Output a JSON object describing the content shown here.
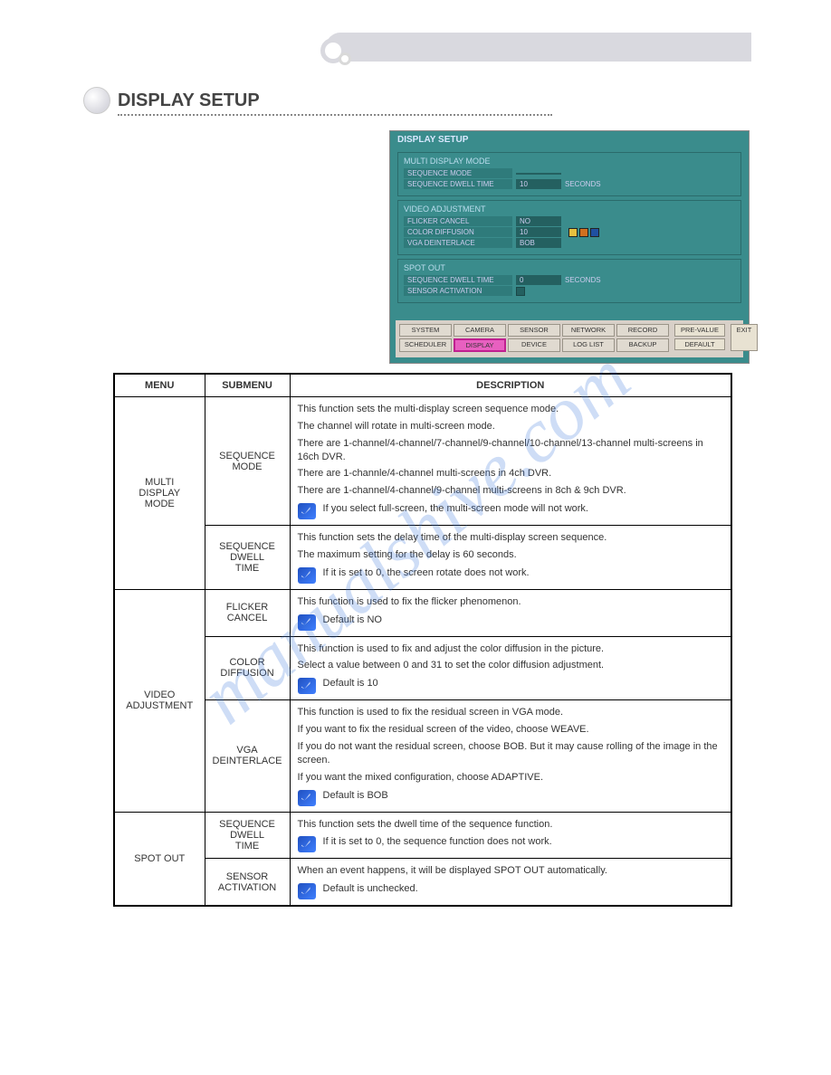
{
  "section_title": "DISPLAY SETUP",
  "watermark": "manualshive.com",
  "screenshot": {
    "title": "DISPLAY SETUP",
    "groups": [
      {
        "title": "MULTI DISPLAY MODE",
        "rows": [
          {
            "label": "SEQUENCE MODE",
            "value": ""
          },
          {
            "label": "SEQUENCE DWELL TIME",
            "value": "10",
            "unit": "SECONDS"
          }
        ]
      },
      {
        "title": "VIDEO ADJUSTMENT",
        "rows": [
          {
            "label": "FLICKER CANCEL",
            "value": "NO"
          },
          {
            "label": "COLOR DIFFUSION",
            "value": "10",
            "swatches": true
          },
          {
            "label": "VGA DEINTERLACE",
            "value": "BOB"
          }
        ]
      },
      {
        "title": "SPOT OUT",
        "rows": [
          {
            "label": "SEQUENCE DWELL TIME",
            "value": "0",
            "unit": "SECONDS"
          },
          {
            "label": "SENSOR ACTIVATION",
            "checkbox": true
          }
        ]
      }
    ],
    "tabs_row1": [
      "SYSTEM",
      "CAMERA",
      "SENSOR",
      "NETWORK",
      "RECORD"
    ],
    "tabs_row2": [
      "SCHEDULER",
      "DISPLAY",
      "DEVICE",
      "LOG LIST",
      "BACKUP"
    ],
    "side_tabs": [
      "PRE-VALUE",
      "DEFAULT"
    ],
    "exit_tab": "EXIT",
    "active_tab": "DISPLAY"
  },
  "table": {
    "headers": [
      "MENU",
      "SUBMENU",
      "DESCRIPTION"
    ],
    "rows": [
      {
        "menu": "MULTI\nDISPLAY\nMODE",
        "submenu": "SEQUENCE\nMODE",
        "lines": [
          "This function sets the multi-display screen sequence mode.",
          "The channel will rotate in multi-screen mode.",
          "There are 1-channel/4-channel/7-channel/9-channel/10-channel/13-channel multi-screens in 16ch DVR.",
          "There are 1-channle/4-channel multi-screens in 4ch DVR.",
          "There are 1-channel/4-channel/9-channel multi-screens in 8ch & 9ch DVR."
        ],
        "note": "If you select full-screen, the multi-screen mode will not work."
      },
      {
        "menu": "",
        "submenu": "SEQUENCE\nDWELL\nTIME",
        "lines": [
          "This function sets the delay time of the multi-display screen sequence.",
          "The maximum setting for the delay is 60 seconds."
        ],
        "note": "If it is set to 0, the screen rotate does not work."
      },
      {
        "menu": "VIDEO\nADJUSTMENT",
        "submenu": "FLICKER\nCANCEL",
        "lines": [
          "This function is used to fix the flicker phenomenon."
        ],
        "note": "Default is NO"
      },
      {
        "menu": "",
        "submenu": "COLOR\nDIFFUSION",
        "lines": [
          "This function is used to fix and adjust the color diffusion in the picture.",
          "Select a value between 0 and 31 to set the color diffusion adjustment."
        ],
        "note": "Default is 10"
      },
      {
        "menu": "",
        "submenu": "VGA\nDEINTERLACE",
        "lines": [
          "This function is used to fix the residual screen in VGA mode.",
          "If you want to fix the residual screen of the video, choose WEAVE.",
          "If you do not want the residual screen, choose BOB. But it may cause rolling of the image in the screen.",
          "If you want the mixed configuration, choose ADAPTIVE."
        ],
        "note": "Default is BOB"
      },
      {
        "menu": "SPOT OUT",
        "submenu": "SEQUENCE\nDWELL\nTIME",
        "lines": [
          "This function sets the dwell time of the sequence function."
        ],
        "note": "If it is set to 0, the sequence function does not work."
      },
      {
        "menu": "",
        "submenu": "SENSOR\nACTIVATION",
        "lines": [
          "When an event happens, it will be displayed SPOT OUT automatically."
        ],
        "note": "Default is unchecked."
      }
    ]
  }
}
